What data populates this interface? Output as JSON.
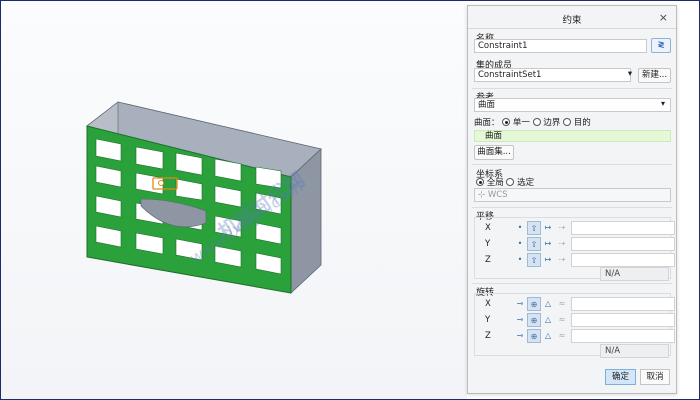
{
  "colors": {
    "accent": "#2aa13a",
    "panel": "#f3f4f6",
    "ok_button": "#d3e6f7",
    "highlight_row": "#e4f7d6"
  },
  "viewport": {
    "marker_label": "○",
    "watermark_cn": "机械时代网",
    "watermark_url": "www.jxage.com"
  },
  "dialog": {
    "title": "约束",
    "close_icon": "×",
    "name_label": "名称",
    "name_value": "Constraint1",
    "set_label": "集的成员",
    "set_value": "ConstraintSet1",
    "new_button": "新建...",
    "reference_label": "参考",
    "reference_value": "曲面",
    "surface_prefix": "曲面：",
    "radio_single": "单一",
    "radio_boundary": "边界",
    "radio_target": "目的",
    "surface_selected": "曲面",
    "surface_set_button": "曲面集...",
    "coord_label": "坐标系",
    "coord_global": "全局",
    "coord_select": "选定",
    "coord_wcs": "WCS",
    "translation_label": "平移",
    "rotation_label": "旋转",
    "axes": [
      "X",
      "Y",
      "Z"
    ],
    "translation_na": "N/A",
    "rotation_na": "N/A",
    "ok_button": "确定",
    "cancel_button": "取消"
  }
}
